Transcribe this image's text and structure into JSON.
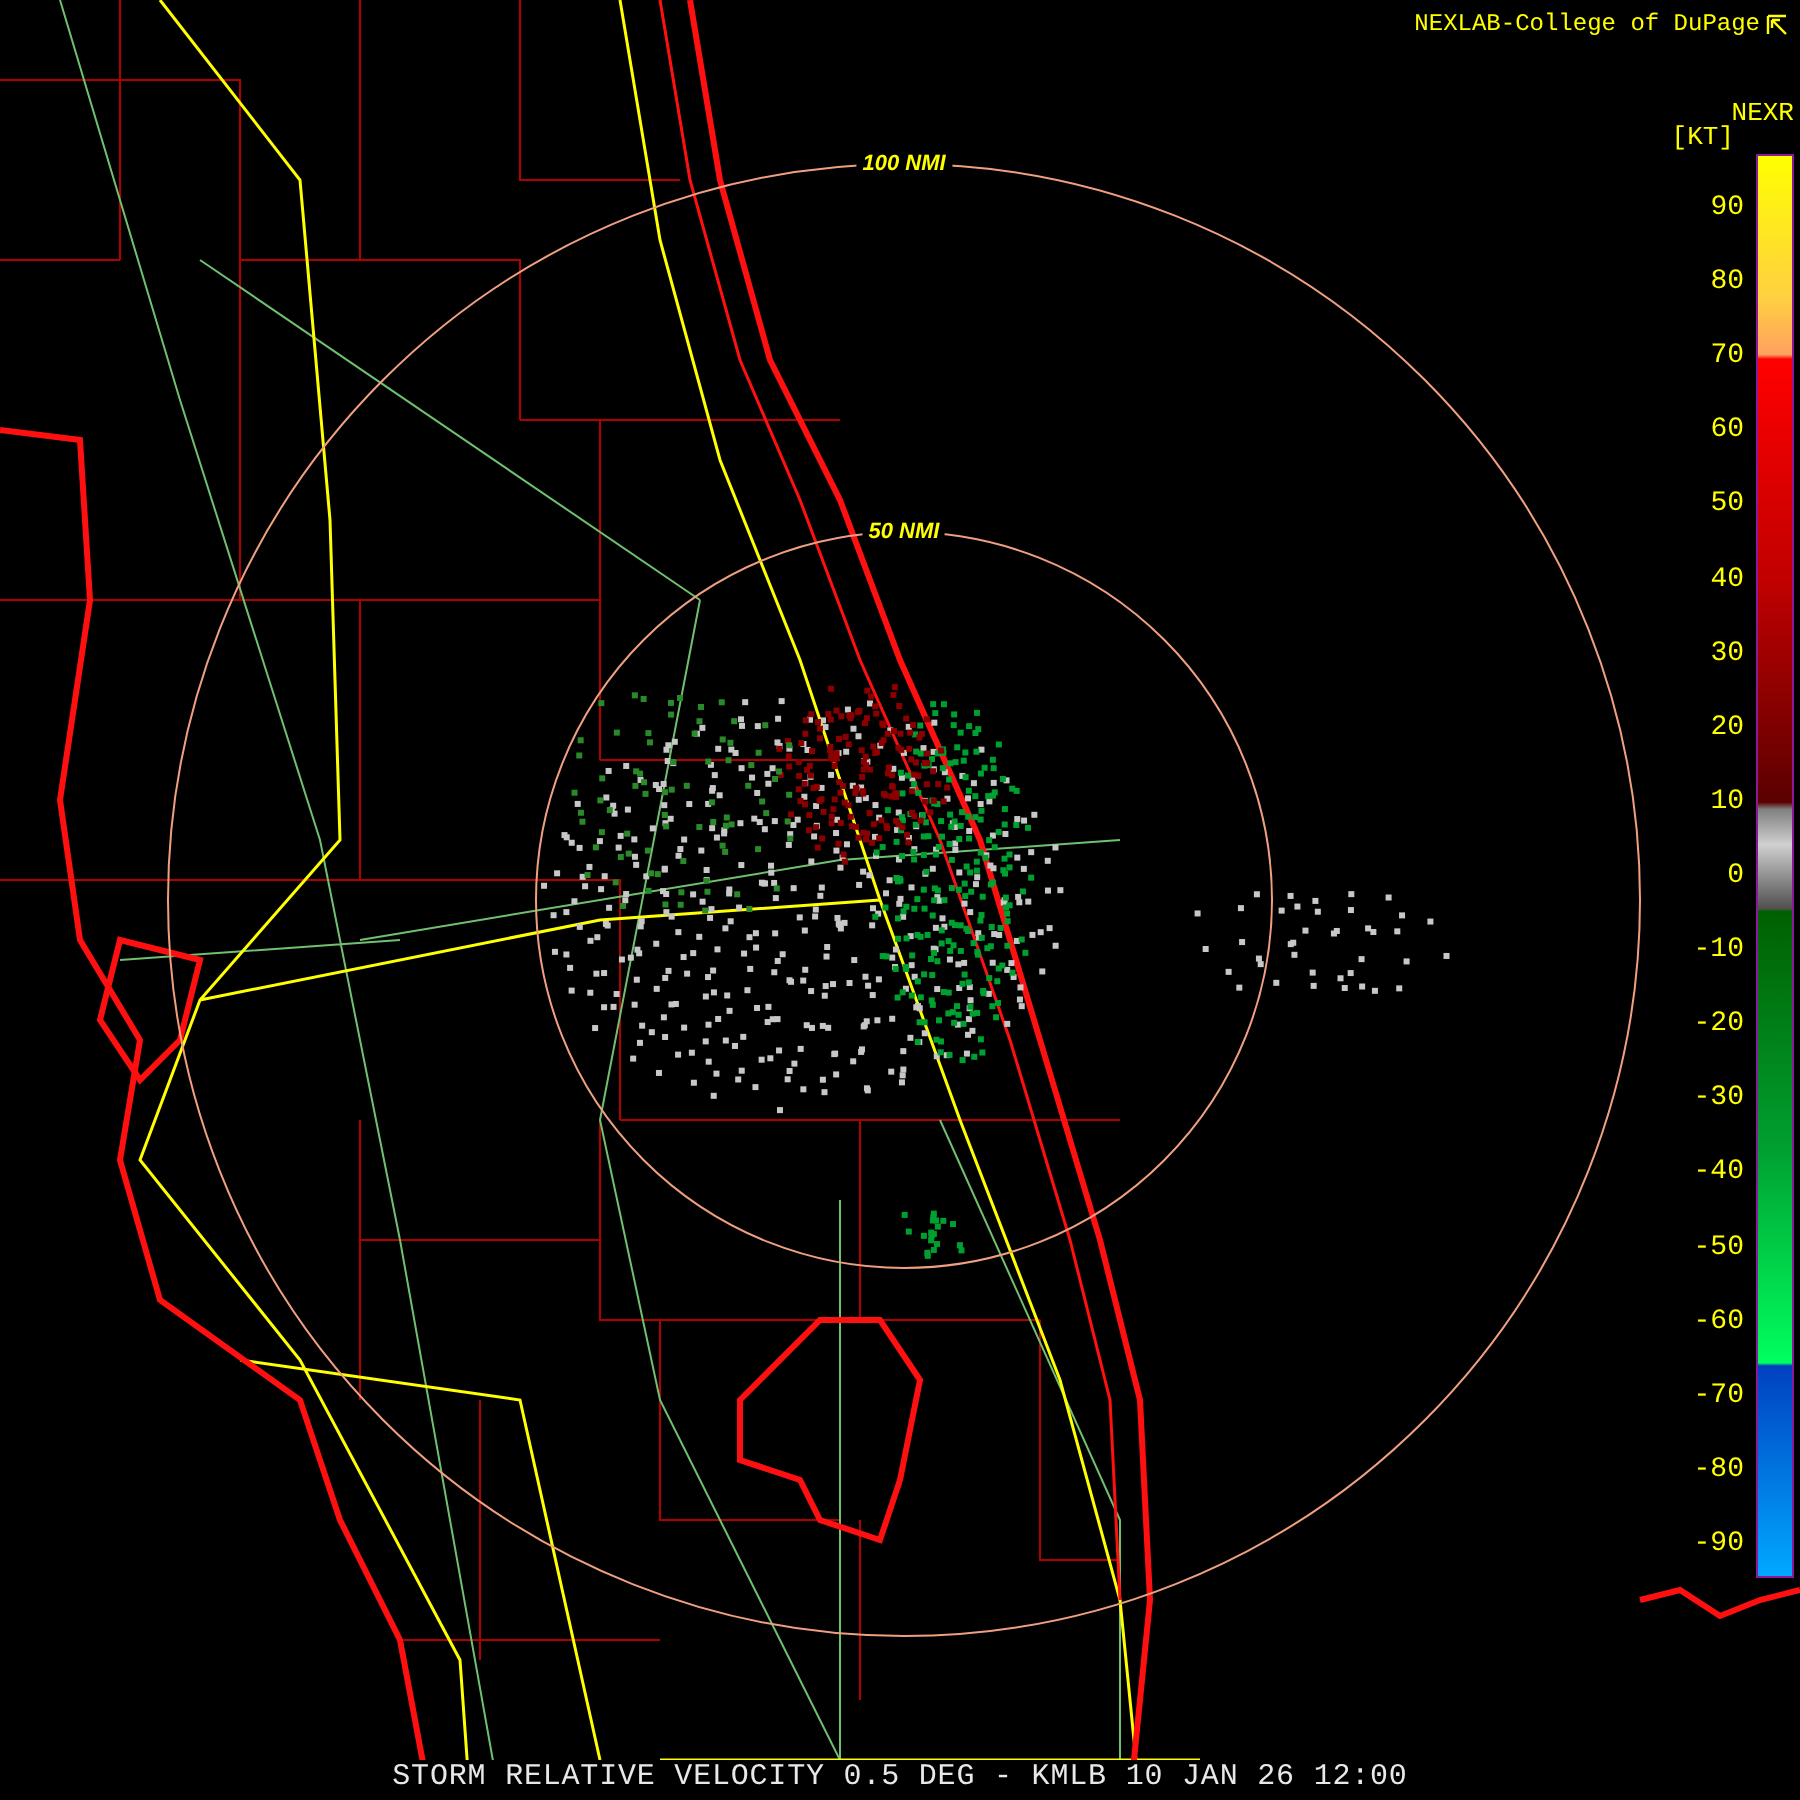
{
  "credit": "NEXLAB-College of DuPage",
  "legend": {
    "product": "NEXR",
    "unit": "[KT]",
    "ticks": [
      "90",
      "80",
      "70",
      "60",
      "50",
      "40",
      "30",
      "20",
      "10",
      "0",
      "-10",
      "-20",
      "-30",
      "-40",
      "-50",
      "-60",
      "-70",
      "-80",
      "-90"
    ]
  },
  "range_rings": [
    {
      "label": "100 NMI"
    },
    {
      "label": "50 NMI"
    }
  ],
  "caption": "STORM RELATIVE VELOCITY 0.5 DEG - KMLB 10 JAN 26 12:00"
}
